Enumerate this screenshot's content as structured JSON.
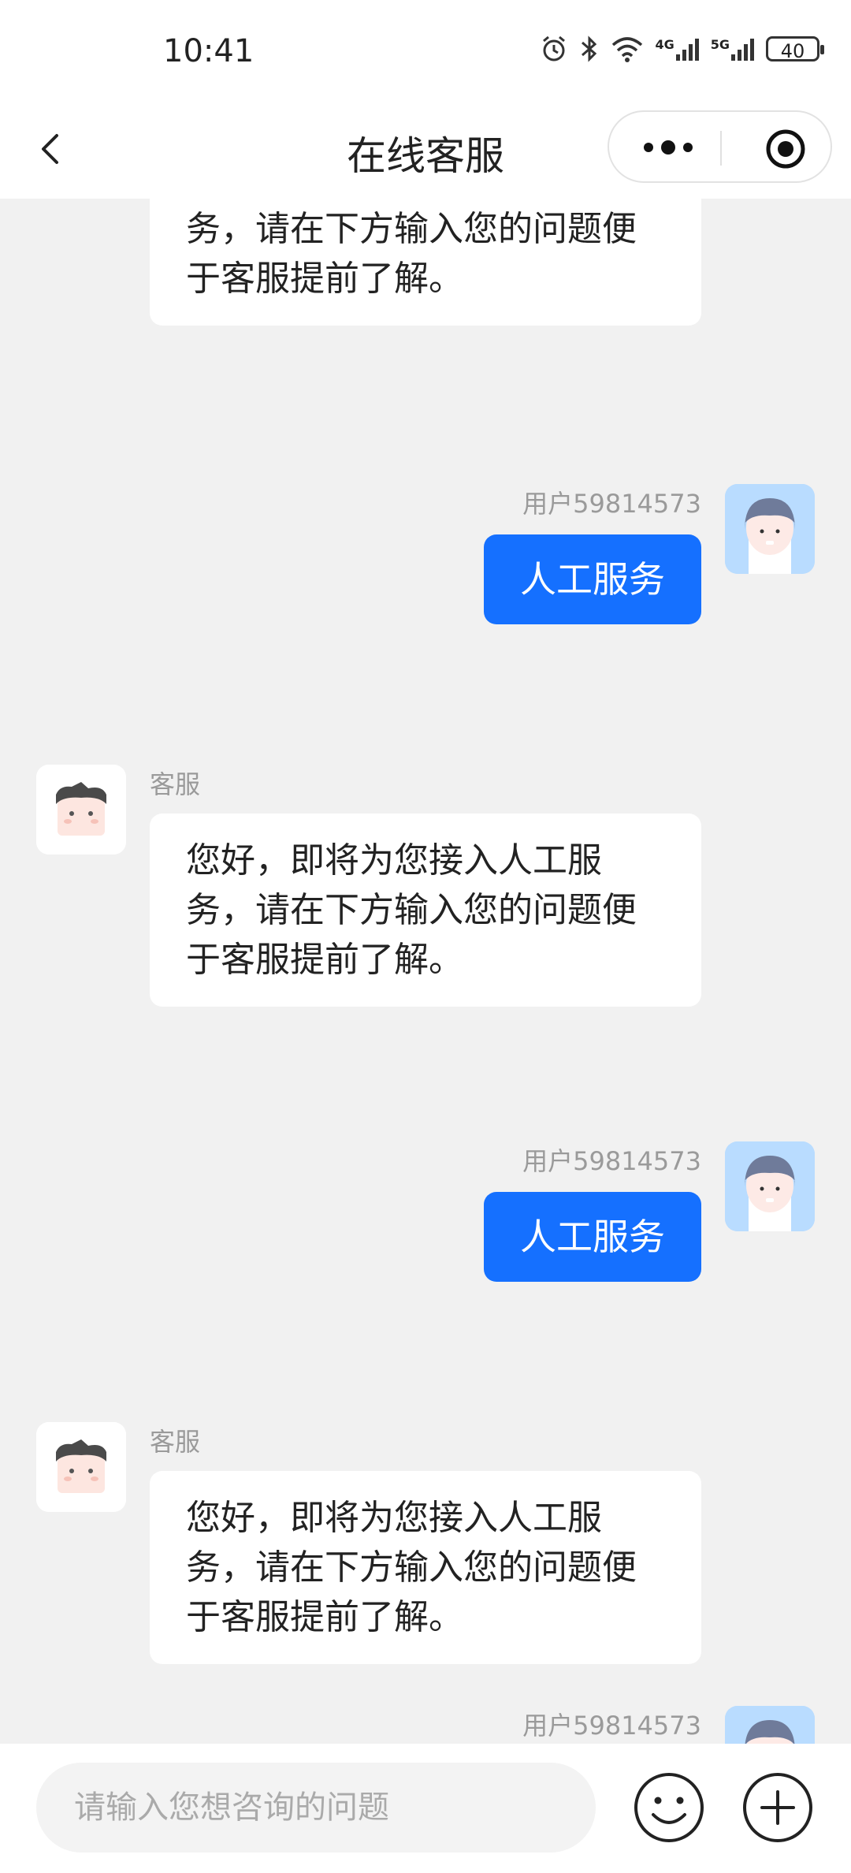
{
  "status_bar": {
    "time": "10:41",
    "battery": "40",
    "signal_1": "4G",
    "signal_2": "5G"
  },
  "nav": {
    "title": "在线客服"
  },
  "chat": {
    "top_partial_bubble": "您好，即将为您接入人工服务，请在下方输入您的问题便于客服提前了解。",
    "messages": [
      {
        "side": "right",
        "sender": "用户59814573",
        "text": "人工服务"
      },
      {
        "side": "left",
        "sender": "客服",
        "text": "您好，即将为您接入人工服务，请在下方输入您的问题便于客服提前了解。"
      },
      {
        "side": "right",
        "sender": "用户59814573",
        "text": "人工服务"
      },
      {
        "side": "left",
        "sender": "客服",
        "text": "您好，即将为您接入人工服务，请在下方输入您的问题便于客服提前了解。"
      },
      {
        "side": "right",
        "sender": "用户59814573",
        "text": ""
      }
    ]
  },
  "input": {
    "placeholder": "请输入您想咨询的问题"
  },
  "colors": {
    "accent": "#1570ff",
    "background": "#f1f1f1"
  }
}
